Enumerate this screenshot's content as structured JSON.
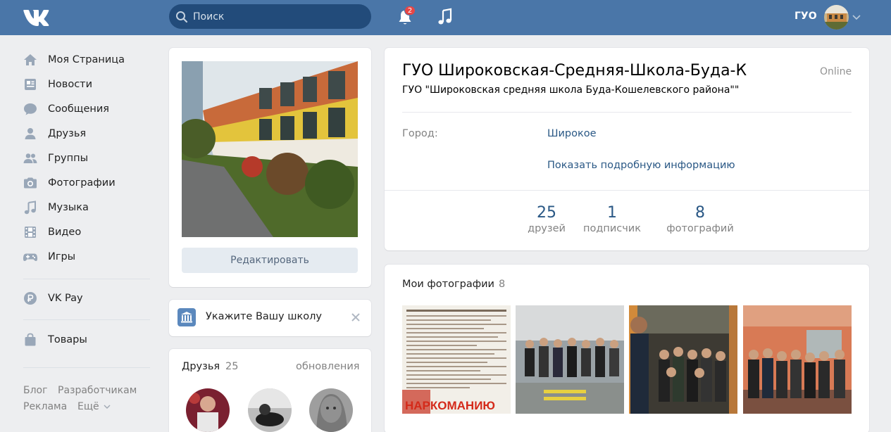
{
  "header": {
    "search_placeholder": "Поиск",
    "notification_count": "2",
    "user_short_name": "ГУО",
    "brand_color": "#4a76a8",
    "icons": [
      "vk-logo",
      "search-icon",
      "bell-icon",
      "music-icon",
      "chevron-down-icon"
    ]
  },
  "sidebar": {
    "items": [
      {
        "label": "Моя Страница",
        "icon": "home-icon"
      },
      {
        "label": "Новости",
        "icon": "news-icon"
      },
      {
        "label": "Сообщения",
        "icon": "messages-icon"
      },
      {
        "label": "Друзья",
        "icon": "friends-icon"
      },
      {
        "label": "Группы",
        "icon": "groups-icon"
      },
      {
        "label": "Фотографии",
        "icon": "camera-icon"
      },
      {
        "label": "Музыка",
        "icon": "music-icon"
      },
      {
        "label": "Видео",
        "icon": "video-icon"
      },
      {
        "label": "Игры",
        "icon": "gamepad-icon"
      },
      {
        "label": "VK Pay",
        "icon": "vk-pay-icon"
      },
      {
        "label": "Товары",
        "icon": "bag-icon"
      }
    ],
    "footer": {
      "blog": "Блог",
      "developers": "Разработчикам",
      "ads": "Реклама",
      "more": "Ещё"
    }
  },
  "profile_photo_card": {
    "edit_button": "Редактировать"
  },
  "school_card": {
    "text": "Укажите Вашу школу"
  },
  "friends_card": {
    "title": "Друзья",
    "count": "25",
    "updates": "обновления"
  },
  "profile": {
    "name": "ГУО Широковская-Средняя-Школа-Буда-К",
    "status": "ГУО \"Широковская средняя школа Буда-Кошелевского района\"\"",
    "online": "Online",
    "city_label": "Город:",
    "city_value": "Широкое",
    "show_more": "Показать подробную информацию",
    "stats": [
      {
        "num": "25",
        "caption": "друзей"
      },
      {
        "num": "1",
        "caption": "подписчик"
      },
      {
        "num": "8",
        "caption": "фотографий"
      }
    ]
  },
  "photos": {
    "title": "Мои фотографии",
    "count": "8",
    "thumb1_caption": "НАРКОМАНИЮ"
  }
}
